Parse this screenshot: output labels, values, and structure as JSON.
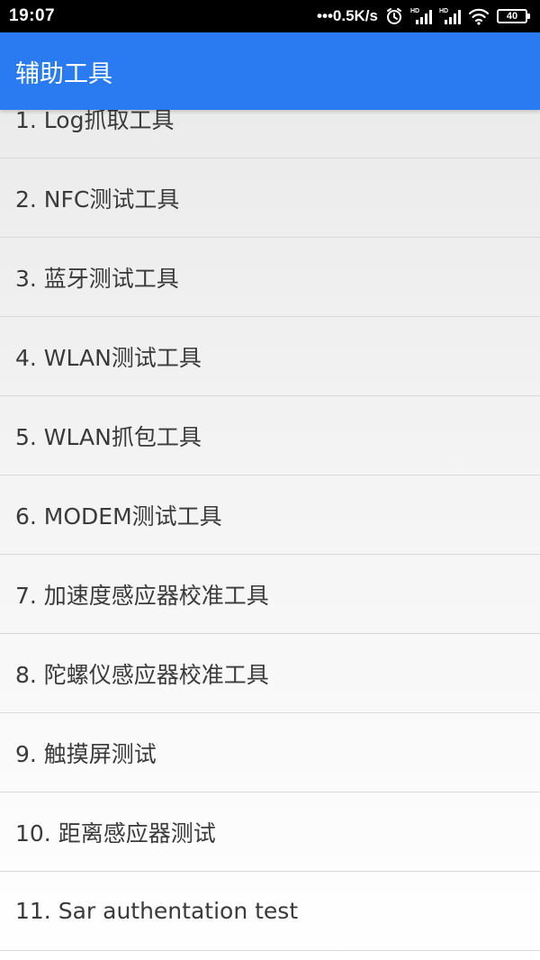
{
  "status_bar": {
    "time": "19:07",
    "network_speed": "•••0.5K/s",
    "icons": [
      "alarm-icon",
      "hd-signal-icon",
      "hd-signal-icon",
      "wifi-icon",
      "battery-icon"
    ],
    "hd_label": "HD",
    "battery_level": "40"
  },
  "app_bar": {
    "title": "辅助工具",
    "color": "#2a7af2"
  },
  "tools": [
    {
      "label": "1. Log抓取工具"
    },
    {
      "label": "2. NFC测试工具"
    },
    {
      "label": "3. 蓝牙测试工具"
    },
    {
      "label": "4. WLAN测试工具"
    },
    {
      "label": "5. WLAN抓包工具"
    },
    {
      "label": "6. MODEM测试工具"
    },
    {
      "label": "7. 加速度感应器校准工具"
    },
    {
      "label": "8. 陀螺仪感应器校准工具"
    },
    {
      "label": "9. 触摸屏测试"
    },
    {
      "label": "10. 距离感应器测试"
    },
    {
      "label": "11. Sar authentation test"
    }
  ]
}
